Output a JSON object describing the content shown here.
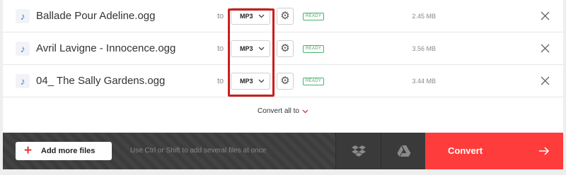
{
  "files": [
    {
      "name": "Ballade Pour Adeline.ogg",
      "to_label": "to",
      "format": "MP3",
      "status": "READY",
      "size": "2.45 MB"
    },
    {
      "name": "Avril Lavigne - Innocence.ogg",
      "to_label": "to",
      "format": "MP3",
      "status": "READY",
      "size": "3.56 MB"
    },
    {
      "name": "04_ The Sally Gardens.ogg",
      "to_label": "to",
      "format": "MP3",
      "status": "READY",
      "size": "3.44 MB"
    }
  ],
  "icons": {
    "file": "music-note-icon",
    "dropdown": "chevron-down-icon",
    "settings": "gear-icon",
    "remove": "close-icon",
    "add": "plus-icon",
    "dropbox": "dropbox-icon",
    "drive": "google-drive-icon",
    "convert": "arrow-right-icon"
  },
  "convert_all": {
    "label": "Convert all to"
  },
  "bottom_bar": {
    "add_files_label": "Add more files",
    "hint": "Use Ctrl or Shift to add several files at once",
    "convert_label": "Convert"
  },
  "colors": {
    "accent_red": "#ff3c3c",
    "ready_green": "#3fa95f",
    "highlight_red": "#cc1d1d",
    "bar_dark": "#3c3c3c"
  }
}
